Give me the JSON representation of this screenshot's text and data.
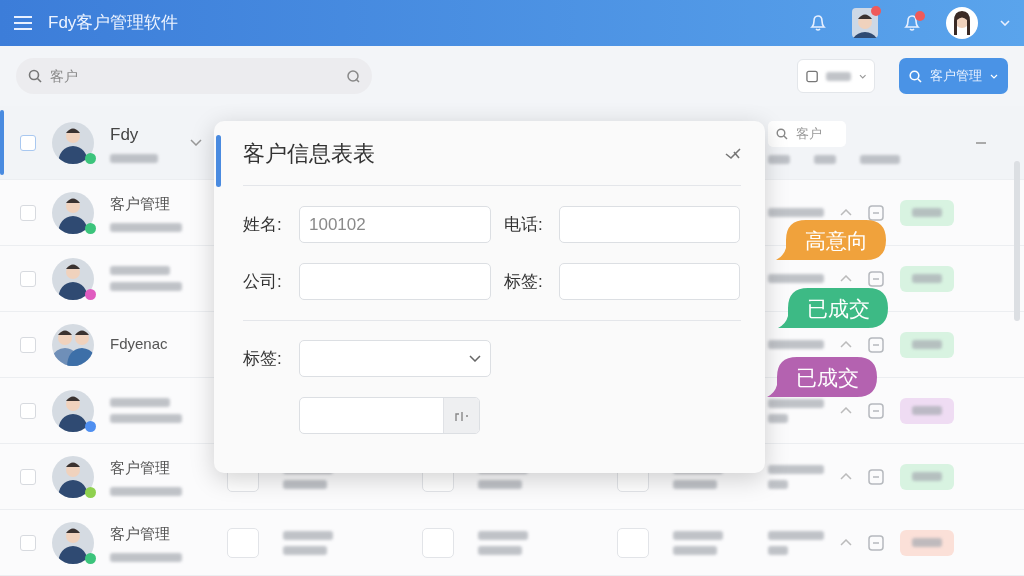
{
  "app": {
    "title": "Fdy客户管理软件"
  },
  "header_icons": [
    {
      "kind": "bell",
      "badge": false
    },
    {
      "kind": "avatar",
      "badge": true
    },
    {
      "kind": "bell",
      "badge": true
    },
    {
      "kind": "user",
      "badge": false
    }
  ],
  "search": {
    "value": "客户"
  },
  "primary_button": {
    "label": "客户管理"
  },
  "customers": [
    {
      "name": "Fdy",
      "selected": true,
      "checked": false,
      "avatar": {
        "kind": "single"
      },
      "color": "#3cc47c",
      "search": "客户"
    },
    {
      "name": "客户管理",
      "selected": false,
      "checked": false,
      "avatar": {
        "kind": "single"
      },
      "color": "#3cc47c",
      "tag": {
        "color": "#d8f3e1"
      }
    },
    {
      "selected": false,
      "checked": false,
      "avatar": {
        "kind": "single"
      },
      "color": "#e05cc0",
      "tag": {
        "color": "#d8f3e1"
      }
    },
    {
      "name": "Fdyenac",
      "selected": false,
      "checked": false,
      "avatar": {
        "kind": "double"
      },
      "tag": {
        "color": "#d8f3e1"
      }
    },
    {
      "selected": false,
      "checked": false,
      "avatar": {
        "kind": "single"
      },
      "color": "#4f8ff0",
      "tag": {
        "color": "#efdcf3"
      }
    },
    {
      "name": "客户管理",
      "selected": false,
      "checked": false,
      "avatar": {
        "kind": "single"
      },
      "color": "#8fd14f",
      "tag": {
        "color": "#d8f3e1"
      }
    },
    {
      "name": "客户管理",
      "selected": false,
      "checked": false,
      "avatar": {
        "kind": "single"
      },
      "color": "#3cc47c",
      "tag": {
        "color": "#fbe0d8"
      }
    }
  ],
  "modal": {
    "title": "客户信息表表",
    "fields": [
      {
        "label": "姓名:",
        "kind": "text",
        "value": "100102"
      },
      {
        "label": "电话:",
        "kind": "text"
      },
      {
        "label": "公司:",
        "kind": "text"
      },
      {
        "label": "标签:",
        "kind": "text"
      },
      {
        "kind": "divider"
      },
      {
        "label": "标签:",
        "kind": "select"
      },
      {
        "kind": "addon"
      }
    ]
  },
  "bubbles": [
    {
      "label": "高意向",
      "color": "#f0a23c"
    },
    {
      "label": "已成交",
      "color": "#3dba85"
    },
    {
      "label": "已成交",
      "color": "#b462b0"
    }
  ]
}
